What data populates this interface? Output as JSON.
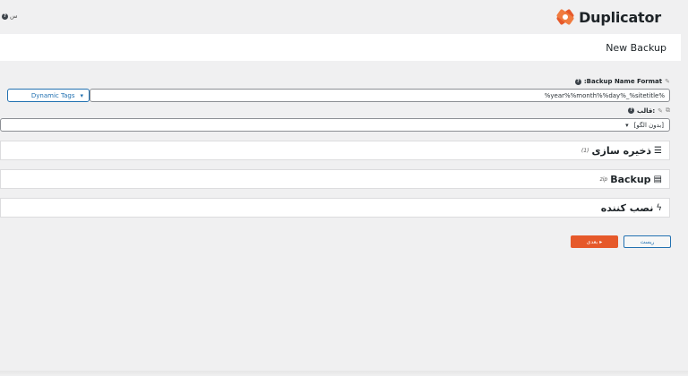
{
  "header": {
    "help_small": "س",
    "logo_text": "Duplicator",
    "brand_color": "#e6592a"
  },
  "page": {
    "title": "New Backup"
  },
  "name_format": {
    "label": ":Backup Name Format",
    "value": "%year%%month%%day%_%sitetitle%",
    "tags_button": "Dynamic Tags"
  },
  "template": {
    "label": "قالب:",
    "selected": "[بدون الگو]"
  },
  "panels": {
    "storage": {
      "title": "ذخیره سازی",
      "count": "(1)",
      "icon": "storage-icon"
    },
    "backup": {
      "title": "Backup",
      "sub": "zip",
      "icon": "file-archive-icon"
    },
    "installer": {
      "title": "نصب کننده",
      "icon": "bolt-icon"
    }
  },
  "actions": {
    "next": "بعدی",
    "reset": "ریست"
  }
}
